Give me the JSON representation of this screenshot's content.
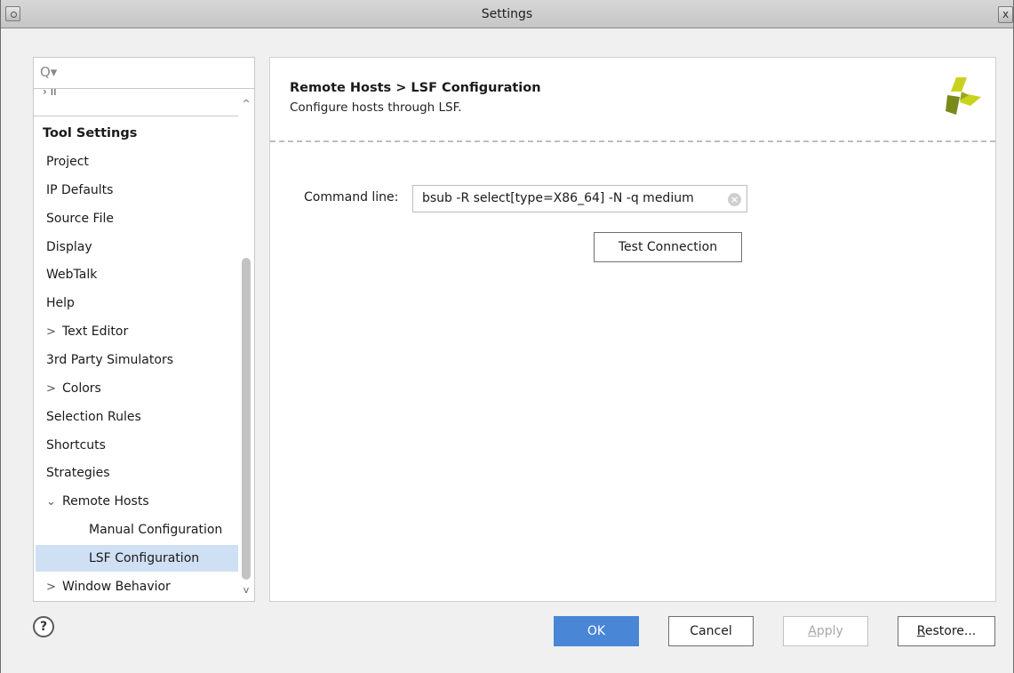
{
  "window": {
    "title": "Settings",
    "close_glyph": "x"
  },
  "search": {
    "placeholder": "",
    "icon": "search-icon",
    "icon_glyph": "Q▾"
  },
  "tree": {
    "cut_item": "› II",
    "section_heading": "Tool Settings",
    "items": [
      {
        "label": "Project",
        "chevron": ""
      },
      {
        "label": "IP Defaults",
        "chevron": ""
      },
      {
        "label": "Source File",
        "chevron": ""
      },
      {
        "label": "Display",
        "chevron": ""
      },
      {
        "label": "WebTalk",
        "chevron": ""
      },
      {
        "label": "Help",
        "chevron": ""
      },
      {
        "label": "Text Editor",
        "chevron": ">"
      },
      {
        "label": "3rd Party Simulators",
        "chevron": ""
      },
      {
        "label": "Colors",
        "chevron": ">"
      },
      {
        "label": "Selection Rules",
        "chevron": ""
      },
      {
        "label": "Shortcuts",
        "chevron": ""
      },
      {
        "label": "Strategies",
        "chevron": ""
      },
      {
        "label": "Remote Hosts",
        "chevron": "⌄"
      },
      {
        "label": "Manual Configuration",
        "chevron": ""
      },
      {
        "label": "LSF Configuration",
        "chevron": ""
      },
      {
        "label": "Window Behavior",
        "chevron": ">"
      }
    ],
    "selected_label": "LSF Configuration"
  },
  "content": {
    "breadcrumb": "Remote Hosts > LSF Configuration",
    "description": "Configure hosts through LSF.",
    "command_line_label": "Command line:",
    "command_line_value": "bsub -R select[type=X86_64] -N -q medium",
    "test_connection_label": "Test Connection"
  },
  "footer": {
    "help_glyph": "?",
    "ok_label": "OK",
    "cancel_label": "Cancel",
    "apply_label_rest": "pply",
    "apply_mnemonic": "A",
    "restore_label_rest": "estore...",
    "restore_mnemonic": "R"
  },
  "colors": {
    "selected_row": "#cfe0f4",
    "ok_button": "#4a86d6",
    "logo_yellow": "#c9d21c",
    "logo_olive": "#7a8a1a"
  }
}
